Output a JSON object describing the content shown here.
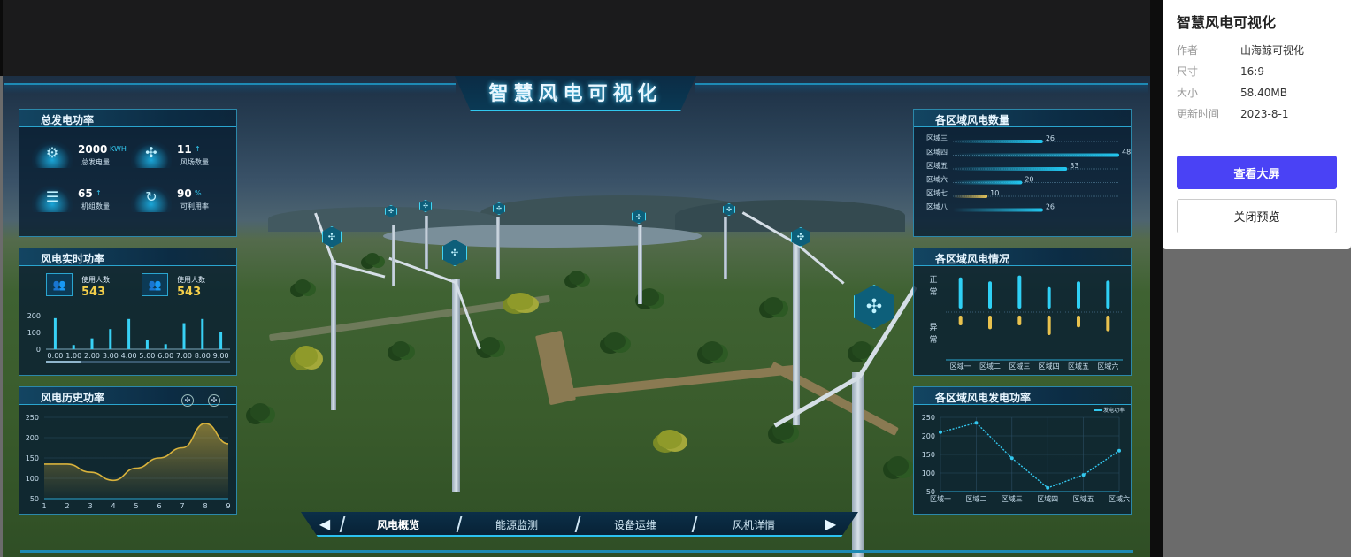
{
  "info_panel": {
    "title": "智慧风电可视化",
    "rows": [
      {
        "key": "作者",
        "value": "山海鲸可视化"
      },
      {
        "key": "尺寸",
        "value": "16:9"
      },
      {
        "key": "大小",
        "value": "58.40MB"
      },
      {
        "key": "更新时间",
        "value": "2023-8-1"
      }
    ],
    "primary_button": "查看大屏",
    "secondary_button": "关闭预览"
  },
  "dashboard": {
    "title": "智慧风电可视化",
    "total_power": {
      "title": "总发电功率",
      "stats": [
        {
          "value": "2000",
          "unit": "KWH",
          "label": "总发电量",
          "icon": "power-gear-icon"
        },
        {
          "value": "11",
          "unit": "↑",
          "label": "风场数量",
          "icon": "wind-farm-icon"
        },
        {
          "value": "65",
          "unit": "↑",
          "label": "机组数量",
          "icon": "unit-stack-icon"
        },
        {
          "value": "90",
          "unit": "%",
          "label": "可利用率",
          "icon": "cycle-icon"
        }
      ]
    },
    "realtime": {
      "title": "风电实时功率",
      "cards": [
        {
          "label": "使用人数",
          "value": "543"
        },
        {
          "label": "使用人数",
          "value": "543"
        }
      ],
      "chart_data": {
        "type": "bar",
        "categories": [
          "0:00",
          "1:00",
          "2:00",
          "3:00",
          "4:00",
          "5:00",
          "6:00",
          "7:00",
          "8:00",
          "9:00"
        ],
        "values": [
          185,
          25,
          65,
          120,
          180,
          55,
          30,
          155,
          180,
          105
        ],
        "yticks": [
          "200",
          "100",
          "0"
        ],
        "ylim": [
          0,
          200
        ]
      }
    },
    "history": {
      "title": "风电历史功率",
      "chart_data": {
        "type": "area",
        "x": [
          "1",
          "2",
          "3",
          "4",
          "5",
          "6",
          "7",
          "8",
          "9"
        ],
        "values": [
          135,
          135,
          115,
          95,
          125,
          150,
          175,
          235,
          185
        ],
        "yticks": [
          "250",
          "200",
          "150",
          "100",
          "50"
        ],
        "ylim": [
          50,
          250
        ],
        "color": "#d8b23c"
      }
    },
    "region_count": {
      "title": "各区域风电数量",
      "chart_data": {
        "type": "bar",
        "orientation": "horizontal",
        "categories": [
          "区域三",
          "区域四",
          "区域五",
          "区域六",
          "区域七",
          "区域八"
        ],
        "values": [
          26,
          48,
          33,
          20,
          10,
          26
        ],
        "xlim": [
          0,
          48
        ],
        "colors": [
          "#22c7f0",
          "#22c7f0",
          "#22c7f0",
          "#22c7f0",
          "#e2c25a",
          "#22c7f0"
        ]
      }
    },
    "region_status": {
      "title": "各区域风电情况",
      "labels": {
        "normal": "正常",
        "abnormal": "异常"
      },
      "chart_data": {
        "type": "bar",
        "categories": [
          "区域一",
          "区域二",
          "区域三",
          "区域四",
          "区域五",
          "区域六"
        ],
        "series": [
          {
            "name": "正常",
            "values": [
              0.8,
              0.7,
              0.85,
              0.55,
              0.7,
              0.72
            ]
          },
          {
            "name": "异常",
            "values": [
              0.25,
              0.35,
              0.25,
              0.5,
              0.3,
              0.4
            ]
          }
        ]
      }
    },
    "region_power": {
      "title": "各区域风电发电功率",
      "legend": "发电功率",
      "chart_data": {
        "type": "line",
        "x": [
          "区域一",
          "区域二",
          "区域三",
          "区域四",
          "区域五",
          "区域六"
        ],
        "values": [
          210,
          235,
          140,
          60,
          95,
          160
        ],
        "yticks": [
          "250",
          "200",
          "150",
          "100",
          "50"
        ],
        "ylim": [
          50,
          250
        ],
        "color": "#33c8ef"
      }
    },
    "nav": {
      "items": [
        "风电概览",
        "能源监测",
        "设备运维",
        "风机详情"
      ],
      "active": 0,
      "prev": "◀",
      "next": "▶"
    }
  }
}
